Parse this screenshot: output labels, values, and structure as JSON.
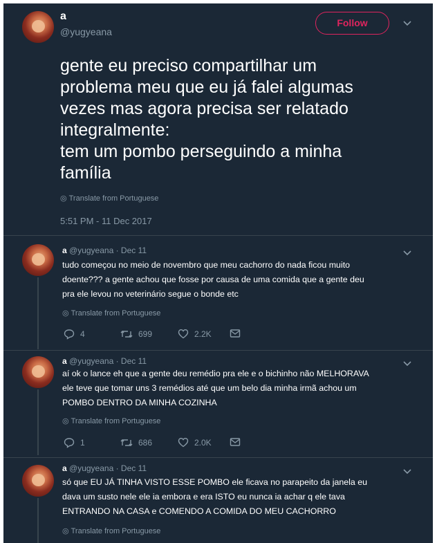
{
  "tweet": {
    "name": "a",
    "handle": "@yugyeana",
    "follow_label": "Follow",
    "text_lines": [
      "gente eu preciso compartilhar um",
      "problema meu que eu já falei algumas",
      "vezes mas agora precisa ser relatado",
      "integralmente:",
      "tem um pombo perseguindo a minha",
      "família"
    ],
    "translate_label": "Translate from Portuguese",
    "timestamp": "5:51 PM - 11 Dec 2017"
  },
  "replies": [
    {
      "name": "a",
      "meta": "@yugyeana · Dec 11",
      "lines": [
        "tudo começou no meio de novembro que meu cachorro do nada ficou muito",
        "doente??? a gente achou que fosse por causa de uma comida que a gente deu",
        "pra ele levou no veterinário segue o bonde etc"
      ],
      "translate_label": "Translate from Portuguese",
      "replies_count": "4",
      "retweets": "699",
      "likes": "2.2K"
    },
    {
      "name": "a",
      "meta": "@yugyeana · Dec 11",
      "lines": [
        "aí ok o lance eh que a gente deu remédio pra ele e o bichinho não MELHORAVA",
        "ele teve que tomar uns 3 remédios até que um belo dia minha irmã achou um",
        "POMBO DENTRO DA MINHA COZINHA"
      ],
      "translate_label": "Translate from Portuguese",
      "replies_count": "1",
      "retweets": "686",
      "likes": "2.0K"
    },
    {
      "name": "a",
      "meta": "@yugyeana · Dec 11",
      "lines": [
        "só que EU JÁ TINHA VISTO ESSE POMBO ele ficava no parapeito da janela eu",
        "dava um susto nele ele ia embora e era ISTO eu nunca ia achar q ele tava",
        "ENTRANDO NA CASA e COMENDO A COMIDA DO MEU CACHORRO"
      ],
      "translate_label": "Translate from Portuguese"
    }
  ],
  "colors": {
    "background": "#1b2836",
    "follow_accent": "#e0245e",
    "secondary_text": "#8899a6",
    "divider": "#38444d"
  },
  "icons": [
    "globe-icon",
    "chevron-down-icon",
    "reply-icon",
    "retweet-icon",
    "like-icon",
    "message-icon"
  ]
}
